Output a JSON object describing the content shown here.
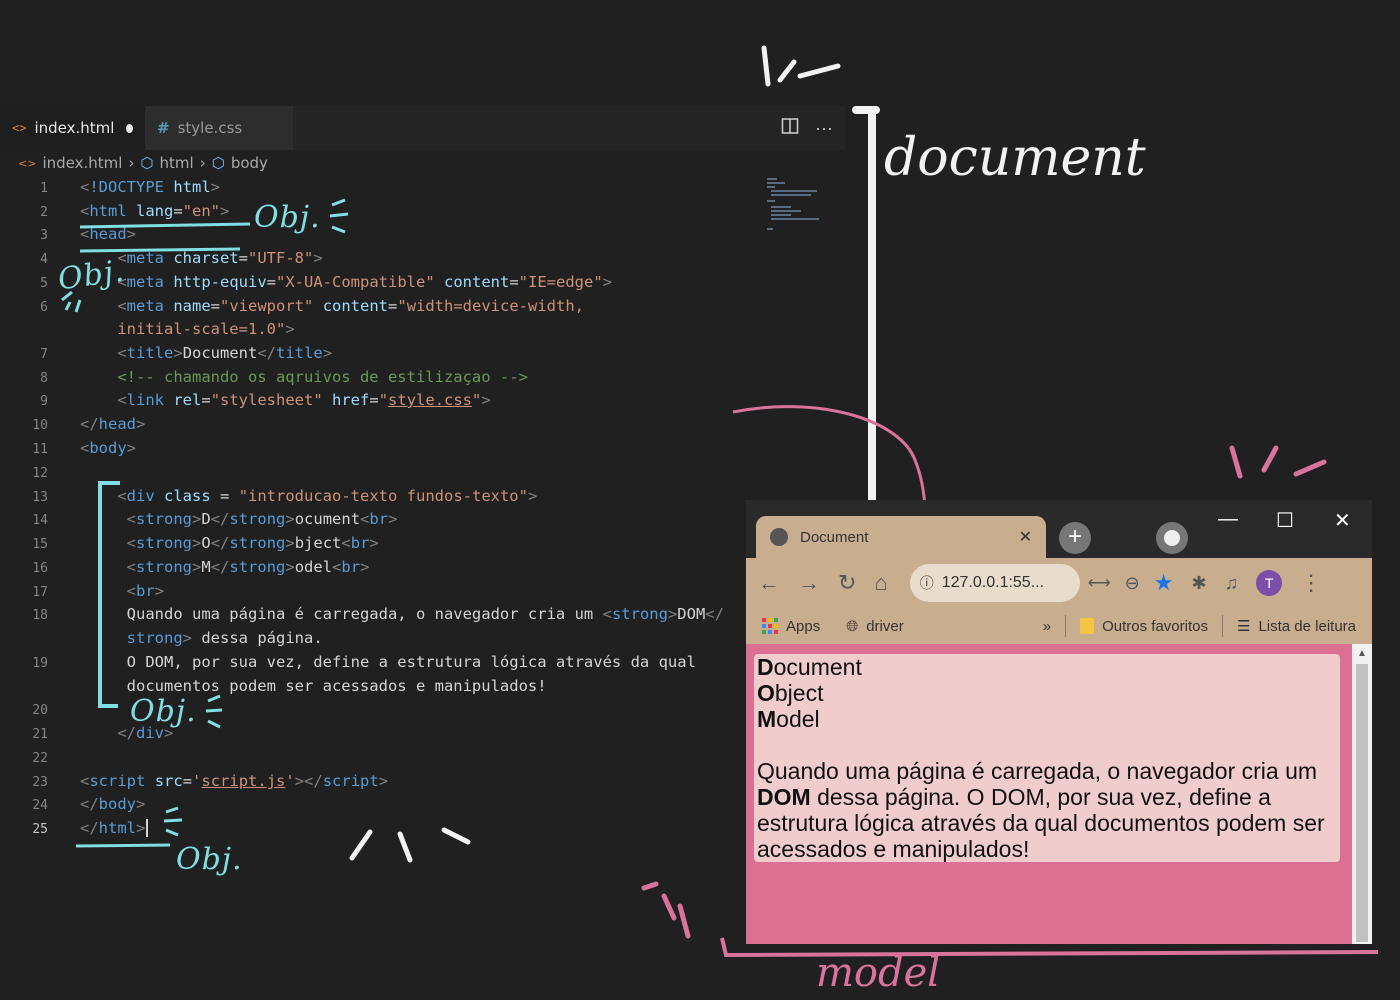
{
  "editor": {
    "tabs": [
      {
        "label": "index.html",
        "icon": "html-file-icon",
        "modified": true,
        "active": true
      },
      {
        "label": "style.css",
        "icon": "css-file-icon",
        "active": false
      }
    ],
    "actions": [
      "split-editor-icon",
      "more-actions-icon"
    ],
    "breadcrumb": [
      "index.html",
      "html",
      "body"
    ],
    "cursor_line": 25
  },
  "minimap": {
    "colors": [
      "#5a6a80"
    ]
  },
  "annotations": {
    "obj_label": "Obj.",
    "document_label": "document",
    "model_label": "model",
    "colors": {
      "cyan": "#7fdfe3",
      "pink": "#d9739c",
      "white": "#f2f2f2"
    }
  },
  "browser": {
    "tab_title": "Document",
    "new_tab": "+",
    "window_controls": {
      "minimize": "—",
      "maximize": "☐",
      "close": "✕"
    },
    "address": "127.0.0.1:55...",
    "avatar_letter": "T",
    "bookmarks": {
      "apps": "Apps",
      "driver": "driver",
      "more": "»",
      "other_favorites": "Outros favoritos",
      "reading_list": "Lista de leitura"
    },
    "page": {
      "line1_bold": "D",
      "line1_rest": "ocument",
      "line2_bold": "O",
      "line2_rest": "bject",
      "line3_bold": "M",
      "line3_rest": "odel",
      "para_start": "Quando uma página é carregada, o navegador cria um",
      "para_bold": "DOM",
      "para_end": "dessa página. O DOM, por sua vez, define a estrutura lógica através da qual documentos podem ser acessados e manipulados!"
    },
    "colors": {
      "chrome": "#c9ad8f",
      "page_bg": "#dc7093",
      "card_bg": "#f0cccc"
    }
  }
}
